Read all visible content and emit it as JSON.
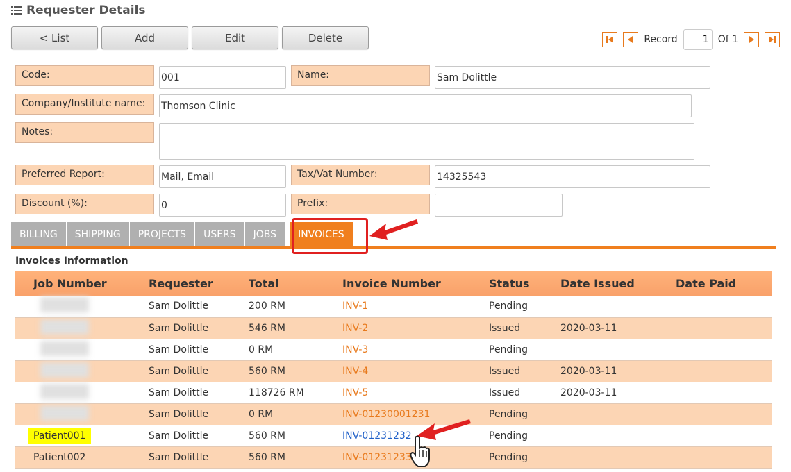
{
  "header": {
    "title": "Requester Details",
    "title_icon": "list-icon"
  },
  "toolbar": {
    "list_label": "< List",
    "add_label": "Add",
    "edit_label": "Edit",
    "delete_label": "Delete"
  },
  "pager": {
    "record_label": "Record",
    "current": "1",
    "of_label": "Of 1"
  },
  "form": {
    "code_label": "Code:",
    "code_value": "001",
    "name_label": "Name:",
    "name_value": "Sam Dolittle",
    "company_label": "Company/Institute name:",
    "company_value": "Thomson Clinic",
    "notes_label": "Notes:",
    "notes_value": "",
    "report_label": "Preferred Report:",
    "report_value": "Mail, Email",
    "tax_label": "Tax/Vat Number:",
    "tax_value": "14325543",
    "discount_label": "Discount (%):",
    "discount_value": "0",
    "prefix_label": "Prefix:",
    "prefix_value": ""
  },
  "tabs": [
    "BILLING",
    "SHIPPING",
    "PROJECTS",
    "USERS",
    "JOBS",
    "INVOICES"
  ],
  "invoices": {
    "section_title": "Invoices Information",
    "columns": [
      "Job Number",
      "Requester",
      "Total",
      "Invoice Number",
      "Status",
      "Date Issued",
      "Date Paid"
    ],
    "rows": [
      {
        "job": "",
        "requester": "Sam Dolittle",
        "total": "200 RM",
        "invoice": "INV-1",
        "status": "Pending",
        "issued": "",
        "paid": ""
      },
      {
        "job": "",
        "requester": "Sam Dolittle",
        "total": "546 RM",
        "invoice": "INV-2",
        "status": "Issued",
        "issued": "2020-03-11",
        "paid": ""
      },
      {
        "job": "",
        "requester": "Sam Dolittle",
        "total": "0 RM",
        "invoice": "INV-3",
        "status": "Pending",
        "issued": "",
        "paid": ""
      },
      {
        "job": "",
        "requester": "Sam Dolittle",
        "total": "560 RM",
        "invoice": "INV-4",
        "status": "Issued",
        "issued": "2020-03-11",
        "paid": ""
      },
      {
        "job": "",
        "requester": "Sam Dolittle",
        "total": "118726 RM",
        "invoice": "INV-5",
        "status": "Issued",
        "issued": "2020-03-11",
        "paid": ""
      },
      {
        "job": "",
        "requester": "Sam Dolittle",
        "total": "0 RM",
        "invoice": "INV-01230001231",
        "status": "Pending",
        "issued": "",
        "paid": ""
      },
      {
        "job": "Patient001",
        "requester": "Sam Dolittle",
        "total": "560 RM",
        "invoice": "INV-01231232",
        "status": "Pending",
        "issued": "",
        "paid": ""
      },
      {
        "job": "Patient002",
        "requester": "Sam Dolittle",
        "total": "560 RM",
        "invoice": "INV-01231233",
        "status": "Pending",
        "issued": "",
        "paid": ""
      }
    ]
  },
  "colors": {
    "accent": "#f07f1e",
    "label_bg": "#fcd5b4",
    "annotation": "#e02020"
  }
}
